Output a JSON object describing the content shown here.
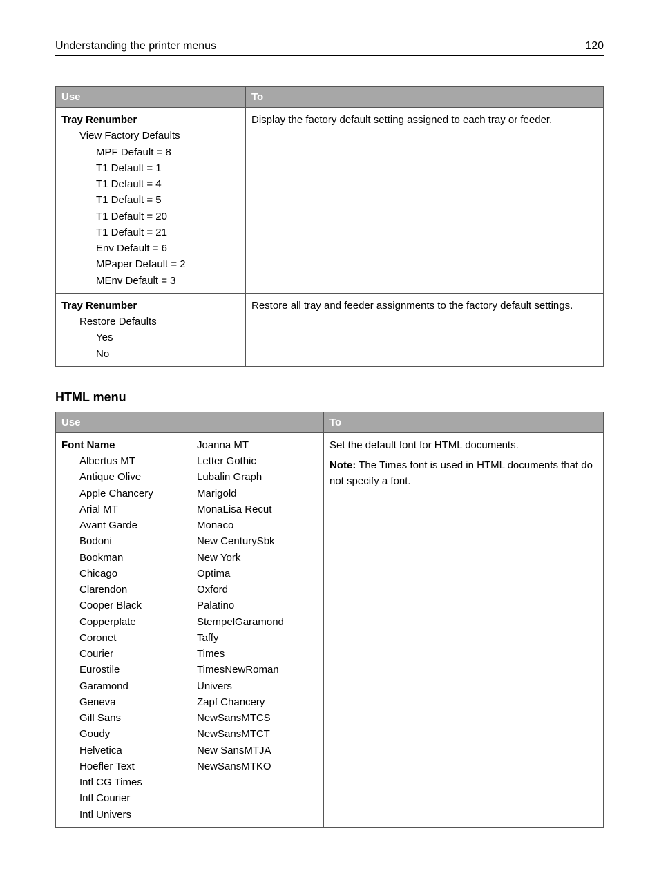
{
  "header": {
    "title": "Understanding the printer menus",
    "page": "120"
  },
  "table1": {
    "head": {
      "use": "Use",
      "to": "To"
    },
    "row1": {
      "title": "Tray Renumber",
      "sub": "View Factory Defaults",
      "items": [
        "MPF Default = 8",
        "T1 Default = 1",
        "T1 Default = 4",
        "T1 Default = 5",
        "T1 Default = 20",
        "T1 Default = 21",
        "Env Default = 6",
        "MPaper Default = 2",
        "MEnv Default = 3"
      ],
      "to": "Display the factory default setting assigned to each tray or feeder."
    },
    "row2": {
      "title": "Tray Renumber",
      "sub": "Restore Defaults",
      "items": [
        "Yes",
        "No"
      ],
      "to": "Restore all tray and feeder assignments to the factory default settings."
    }
  },
  "section2": {
    "heading": "HTML menu"
  },
  "table2": {
    "head": {
      "use": "Use",
      "to": "To"
    },
    "row1": {
      "title": "Font Name",
      "colA": [
        "Albertus MT",
        "Antique Olive",
        "Apple Chancery",
        "Arial MT",
        "Avant Garde",
        "Bodoni",
        "Bookman",
        "Chicago",
        "Clarendon",
        "Cooper Black",
        "Copperplate",
        "Coronet",
        "Courier",
        "Eurostile",
        "Garamond",
        "Geneva",
        "Gill Sans",
        "Goudy",
        "Helvetica",
        "Hoefler Text",
        "Intl CG Times",
        "Intl Courier",
        "Intl Univers"
      ],
      "colB": [
        "Joanna MT",
        "Letter Gothic",
        "Lubalin Graph",
        "Marigold",
        "MonaLisa Recut",
        "Monaco",
        "New CenturySbk",
        "New York",
        "Optima",
        "Oxford",
        "Palatino",
        "StempelGaramond",
        "Taffy",
        "Times",
        "TimesNewRoman",
        "Univers",
        "Zapf Chancery",
        "NewSansMTCS",
        "NewSansMTCT",
        "New SansMTJA",
        "NewSansMTKO"
      ],
      "to_line1": "Set the default font for HTML documents.",
      "note_label": "Note:",
      "note_text": " The Times font is used in HTML documents that do not specify a font."
    }
  }
}
